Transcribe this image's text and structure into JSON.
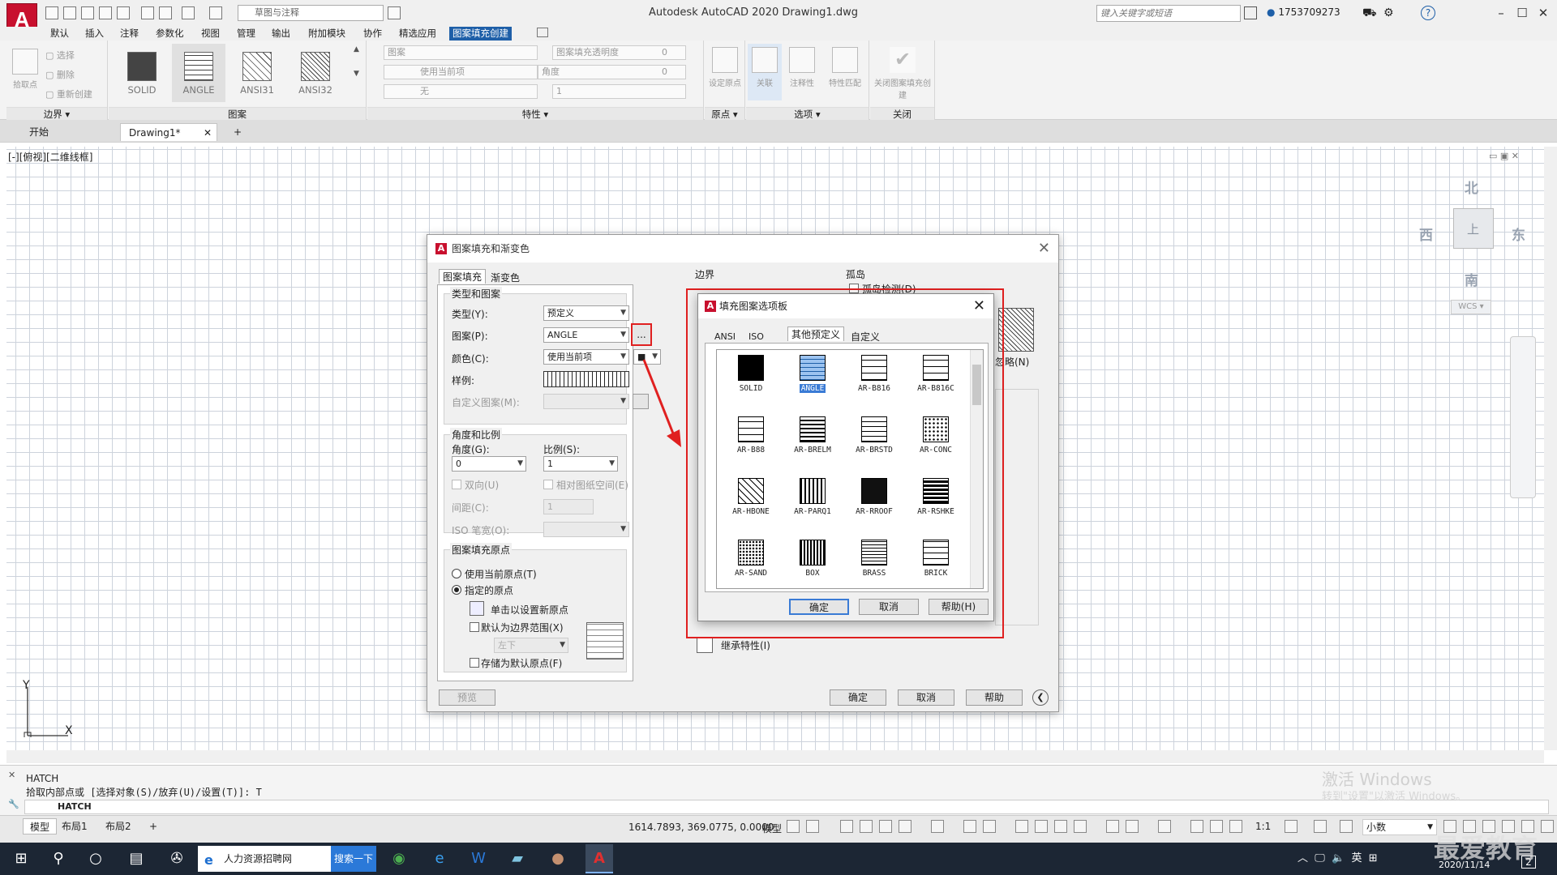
{
  "app": {
    "logo_letter": "A",
    "workspace": "草图与注释",
    "window_title": "Autodesk AutoCAD 2020    Drawing1.dwg",
    "search_placeholder": "键入关键字或短语",
    "user": "1753709273"
  },
  "menu_tabs": [
    "默认",
    "插入",
    "注释",
    "参数化",
    "视图",
    "管理",
    "输出",
    "附加模块",
    "协作",
    "精选应用",
    "图案填充创建"
  ],
  "ribbon": {
    "boundary": {
      "pick_label": "拾取点",
      "select": "选择",
      "remove": "删除",
      "recreate": "重新创建",
      "panel": "边界"
    },
    "patterns": {
      "items": [
        "SOLID",
        "ANGLE",
        "ANSI31",
        "ANSI32"
      ],
      "panel": "图案"
    },
    "properties": {
      "pattern_type": "图案",
      "transparency_label": "图案填充透明度",
      "transparency_value": "0",
      "color": "使用当前项",
      "angle_label": "角度",
      "angle_value": "0",
      "bg": "无",
      "scale_value": "1",
      "panel": "特性"
    },
    "origin": {
      "label": "设定原点",
      "panel": "原点"
    },
    "options": {
      "associative": "关联",
      "annotative": "注释性",
      "match": "特性匹配",
      "panel": "选项"
    },
    "close": {
      "label": "关闭图案填充创建",
      "panel": "关闭"
    }
  },
  "doc_tabs": {
    "start": "开始",
    "drawing": "Drawing1*",
    "add": "+"
  },
  "viewport": {
    "label": "[-][俯视][二维线框]",
    "north": "北",
    "south": "南",
    "east": "东",
    "west": "西",
    "top": "上",
    "wcs": "WCS",
    "ucs_x": "X",
    "ucs_y": "Y"
  },
  "hatch_dialog": {
    "title": "图案填充和渐变色",
    "tabs": [
      "图案填充",
      "渐变色"
    ],
    "type_and_pattern": "类型和图案",
    "type_label": "类型(Y):",
    "type_value": "预定义",
    "pattern_label": "图案(P):",
    "pattern_value": "ANGLE",
    "browse_btn": "...",
    "color_label": "颜色(C):",
    "color_value": "使用当前项",
    "swatch_label": "样例:",
    "custom_label": "自定义图案(M):",
    "angle_scale": "角度和比例",
    "angle_label": "角度(G):",
    "angle_value": "0",
    "scale_label": "比例(S):",
    "scale_value": "1",
    "double": "双向(U)",
    "relative": "相对图纸空间(E)",
    "spacing_label": "间距(C):",
    "spacing_value": "1",
    "iso_label": "ISO 笔宽(O):",
    "origin_group": "图案填充原点",
    "use_current": "使用当前原点(T)",
    "specified": "指定的原点",
    "click_set": "单击以设置新原点",
    "default_extent": "默认为边界范围(X)",
    "extent_value": "左下",
    "store_default": "存储为默认原点(F)",
    "preview": "预览",
    "ok": "确定",
    "cancel": "取消",
    "help": "帮助",
    "boundary": "边界",
    "islands": "孤岛",
    "island_detect": "孤岛检测(D)",
    "ignore": "忽略(N)",
    "inherit": "继承特性(I)"
  },
  "palette": {
    "title": "填充图案选项板",
    "tabs": [
      "ANSI",
      "ISO",
      "其他预定义",
      "自定义"
    ],
    "patterns": [
      "SOLID",
      "ANGLE",
      "AR-B816",
      "AR-B816C",
      "AR-B88",
      "AR-BRELM",
      "AR-BRSTD",
      "AR-CONC",
      "AR-HBONE",
      "AR-PARQ1",
      "AR-RROOF",
      "AR-RSHKE",
      "AR-SAND",
      "BOX",
      "BRASS",
      "BRICK"
    ],
    "selected": "ANGLE",
    "ok": "确定",
    "cancel": "取消",
    "help": "帮助(H)"
  },
  "command": {
    "line1": "HATCH",
    "line2": "拾取内部点或 [选择对象(S)/放弃(U)/设置(T)]: T",
    "prompt": "HATCH"
  },
  "status": {
    "layouts": [
      "模型",
      "布局1",
      "布局2"
    ],
    "coords": "1614.7893, 369.0775, 0.0000",
    "model": "模型",
    "scale": "1:1",
    "units": "小数"
  },
  "watermark": {
    "line1": "激活 Windows",
    "line2": "转到\"设置\"以激活 Windows。"
  },
  "taskbar": {
    "search_text": "人力资源招聘网",
    "search_btn": "搜索一下",
    "ime": "英",
    "time": "2020/11/14",
    "notif": "2",
    "brand": "最爱教育"
  }
}
